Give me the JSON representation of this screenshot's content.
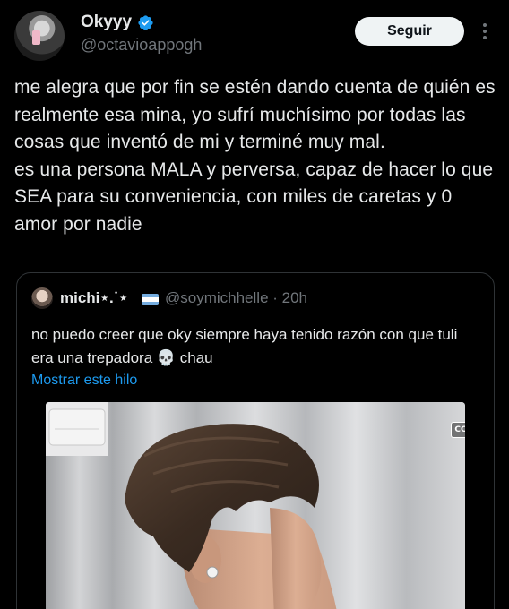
{
  "author": {
    "display_name": "Okyyy",
    "handle": "@octavioappogh",
    "verified": true
  },
  "header": {
    "follow_label": "Seguir",
    "more_icon": "more-vertical-icon"
  },
  "tweet": {
    "text": "me alegra que por fin se estén dando cuenta de quién es realmente esa mina, yo sufrí muchísimo por todas las cosas que inventó de mi y terminé muy mal.\nes una persona MALA y perversa, capaz de hacer lo que SEA para su conveniencia, con miles de caretas y 0 amor por nadie"
  },
  "quote": {
    "display_name": "michi⋆.˙⋆",
    "handle_time": "@soymichhelle · 20h",
    "text": "no puedo creer que oky siempre haya tenido razón con que tuli era una trepadora 💀 chau",
    "show_thread_label": "Mostrar este hilo",
    "cc_label": "CC"
  },
  "colors": {
    "background": "#000000",
    "text": "#e7e9ea",
    "secondary": "#71767b",
    "link": "#1d9bf0",
    "verified": "#1d9bf0",
    "border": "#2f3336"
  }
}
